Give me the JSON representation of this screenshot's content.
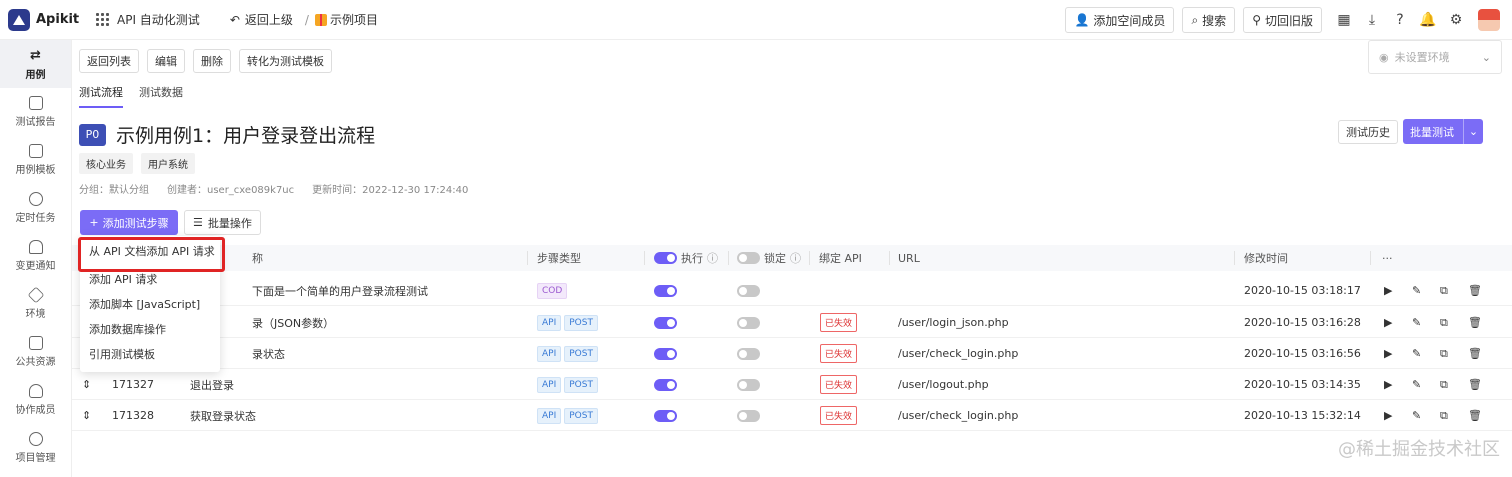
{
  "app": {
    "logo_text": "Apikit",
    "project_name": "API 自动化测试",
    "back_label": "返回上级",
    "example_label": "示例项目"
  },
  "topbar": {
    "add_member": "添加空间成员",
    "search": "搜索",
    "switch_old": "切回旧版"
  },
  "sidebar": {
    "items": [
      {
        "label": "用例",
        "icon": "swap-arrows-icon",
        "active": true
      },
      {
        "label": "测试报告",
        "icon": "report-icon"
      },
      {
        "label": "用例模板",
        "icon": "template-icon"
      },
      {
        "label": "定时任务",
        "icon": "timer-icon"
      },
      {
        "label": "变更通知",
        "icon": "bell-icon"
      },
      {
        "label": "环境",
        "icon": "cube-icon"
      },
      {
        "label": "公共资源",
        "icon": "puzzle-icon"
      },
      {
        "label": "协作成员",
        "icon": "users-icon"
      },
      {
        "label": "项目管理",
        "icon": "gear-icon"
      }
    ]
  },
  "toolbar": {
    "back_list": "返回列表",
    "edit": "编辑",
    "delete": "删除",
    "convert": "转化为测试模板"
  },
  "env": {
    "placeholder": "未设置环境"
  },
  "tabs": [
    "测试流程",
    "测试数据"
  ],
  "case": {
    "priority": "P0",
    "title": "示例用例1：用户登录登出流程",
    "tags": [
      "核心业务",
      "用户系统"
    ],
    "group": "分组：默认分组",
    "creator": "创建者：user_cxe089k7uc",
    "updated": "更新时间：2022-12-30 17:24:40",
    "history": "测试历史",
    "batch_test": "批量测试"
  },
  "actions": {
    "add_step": "添加测试步骤",
    "batch_op": "批量操作"
  },
  "table": {
    "headers": {
      "name": "称",
      "type": "步骤类型",
      "exec": "执行",
      "lock": "锁定",
      "bind": "绑定 API",
      "url": "URL",
      "modified": "修改时间",
      "more": "···"
    },
    "rows": [
      {
        "id": "",
        "name": "下面是一个简单的用户登录流程测试",
        "type": [
          "COD"
        ],
        "exec": true,
        "lock": false,
        "bind": "",
        "url": "",
        "time": "2020-10-15 03:18:17"
      },
      {
        "id": "",
        "name": "录（JSON参数）",
        "type": [
          "API",
          "POST"
        ],
        "exec": true,
        "lock": false,
        "bind": "已失效",
        "url": "/user/login_json.php",
        "time": "2020-10-15 03:16:28"
      },
      {
        "id": "",
        "name": "录状态",
        "type": [
          "API",
          "POST"
        ],
        "exec": true,
        "lock": false,
        "bind": "已失效",
        "url": "/user/check_login.php",
        "time": "2020-10-15 03:16:56"
      },
      {
        "id": "171327",
        "name": "退出登录",
        "type": [
          "API",
          "POST"
        ],
        "exec": true,
        "lock": false,
        "bind": "已失效",
        "url": "/user/logout.php",
        "time": "2020-10-15 03:14:35"
      },
      {
        "id": "171328",
        "name": "获取登录状态",
        "type": [
          "API",
          "POST"
        ],
        "exec": true,
        "lock": false,
        "bind": "已失效",
        "url": "/user/check_login.php",
        "time": "2020-10-13 15:32:14"
      }
    ]
  },
  "menu": {
    "items": [
      "从 API 文档添加 API 请求",
      "添加 API 请求",
      "添加脚本 [JavaScript]",
      "添加数据库操作",
      "引用测试模板"
    ]
  },
  "watermark": "@稀土掘金技术社区",
  "colors": {
    "accent": "#6d5df6",
    "highlight": "#e02424"
  }
}
